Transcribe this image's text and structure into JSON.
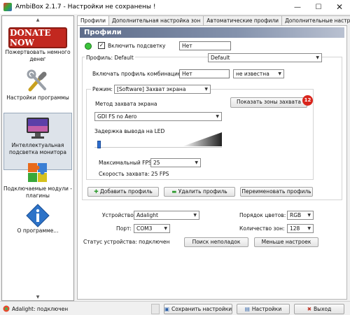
{
  "window": {
    "title": "AmbiBox 2.1.7  -  Настройки не сохранены !"
  },
  "sidebar": {
    "donate_text": "DONATE NOW",
    "items": [
      {
        "label": "Пожертвовать немного денег"
      },
      {
        "label": "Настройки программы"
      },
      {
        "label": "Интеллектуальная подсветка монитора"
      },
      {
        "label": "Подключаемые модули - плагины"
      },
      {
        "label": "О программе..."
      }
    ]
  },
  "tabs": [
    "Профили",
    "Дополнительная настройка зон",
    "Автоматические профили",
    "Дополнительные настройки"
  ],
  "profiles": {
    "header": "Профили",
    "enable_label": "Включить подсветку",
    "enable_checked": true,
    "enable_value": "Нет",
    "profile_caption": "Профиль: Default",
    "profile_select": "Default",
    "combo_label": "Включать профиль комбинацией:",
    "combo_value": "Нет",
    "combo_status": "не известна",
    "mode_label": "Режим:",
    "mode_value": "[Software] Захват экрана",
    "capture_method_label": "Метод захвата экрана",
    "capture_method_value": "GDI FS no Aero",
    "show_zones_button": "Показать зоны захвата",
    "badge": "12",
    "delay_label": "Задержка вывода на LED",
    "delay_level": 0.02,
    "max_fps_label": "Максимальный FPS",
    "max_fps_value": "25",
    "capture_speed": "Скорость захвата: 25 FPS",
    "add_profile": "Добавить профиль",
    "delete_profile": "Удалить профиль",
    "rename_profile": "Переименовать профиль"
  },
  "device": {
    "device_label": "Устройство:",
    "device_value": "Adalight",
    "port_label": "Порт:",
    "port_value": "COM3",
    "color_order_label": "Порядок цветов:",
    "color_order_value": "RGB",
    "zones_label": "Количество зон:",
    "zones_value": "128",
    "status": "Статус устройства: подключен",
    "find_faults": "Поиск неполадок",
    "fewer_settings": "Меньше настроек"
  },
  "statusbar": {
    "status_text": "Adalight: подключен",
    "save": "Сохранить настройки",
    "settings": "Настройки",
    "exit": "Выход"
  },
  "colors": {
    "header": "#6e7d99",
    "badge": "#d9251c",
    "donate": "#c2281f",
    "add_green": "#2e9a2e"
  }
}
